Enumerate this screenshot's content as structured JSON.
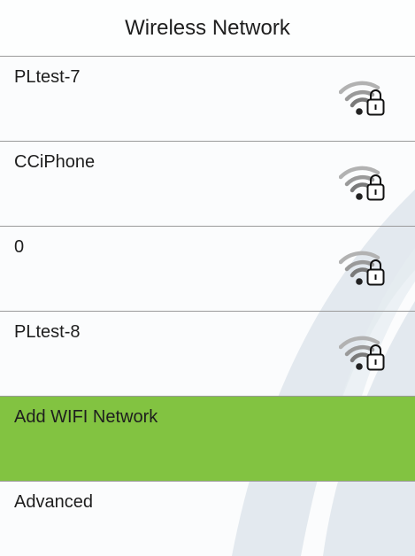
{
  "header": {
    "title": "Wireless Network"
  },
  "networks": [
    {
      "ssid": "PLtest-7",
      "icon": "wifi-lock-icon"
    },
    {
      "ssid": "CCiPhone",
      "icon": "wifi-lock-icon"
    },
    {
      "ssid": "0",
      "icon": "wifi-lock-icon"
    },
    {
      "ssid": "PLtest-8",
      "icon": "wifi-lock-icon"
    }
  ],
  "actions": {
    "add_network_label": "Add WIFI Network",
    "advanced_label": "Advanced"
  },
  "colors": {
    "highlight": "#82c341",
    "divider": "#9a9a9a",
    "decoration": "#d5dee6"
  }
}
